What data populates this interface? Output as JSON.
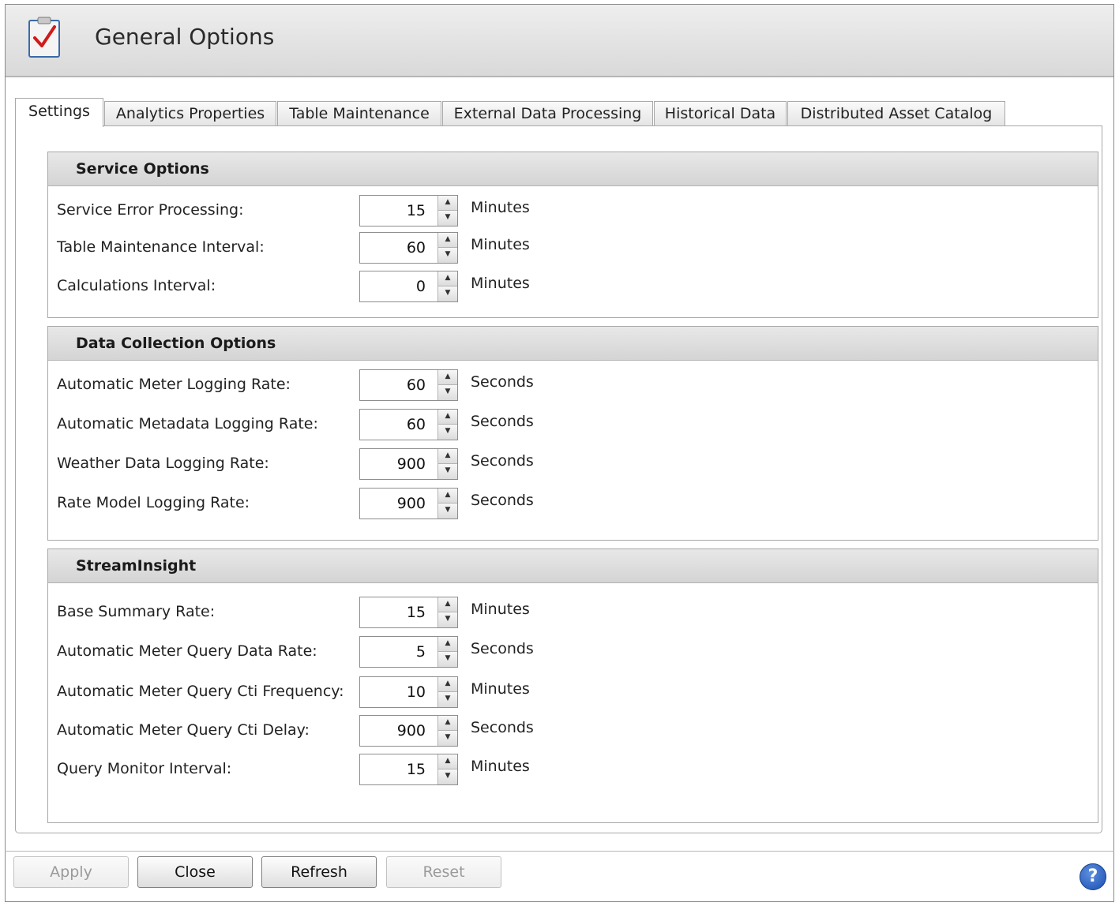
{
  "window": {
    "title": "General Options"
  },
  "tabs": [
    {
      "label": "Settings",
      "active": true
    },
    {
      "label": "Analytics Properties",
      "active": false
    },
    {
      "label": "Table Maintenance",
      "active": false
    },
    {
      "label": "External Data Processing",
      "active": false
    },
    {
      "label": "Historical Data",
      "active": false
    },
    {
      "label": "Distributed Asset Catalog",
      "active": false
    }
  ],
  "service_options": {
    "title": "Service Options",
    "rows": [
      {
        "label": "Service Error Processing:",
        "value": "15",
        "unit": "Minutes"
      },
      {
        "label": "Table Maintenance Interval:",
        "value": "60",
        "unit": "Minutes"
      },
      {
        "label": "Calculations Interval:",
        "value": "0",
        "unit": "Minutes"
      }
    ]
  },
  "data_collection": {
    "title": "Data Collection Options",
    "rows": [
      {
        "label": "Automatic Meter Logging Rate:",
        "value": "60",
        "unit": "Seconds"
      },
      {
        "label": "Automatic Metadata Logging Rate:",
        "value": "60",
        "unit": "Seconds"
      },
      {
        "label": "Weather Data Logging Rate:",
        "value": "900",
        "unit": "Seconds"
      },
      {
        "label": "Rate Model Logging Rate:",
        "value": "900",
        "unit": "Seconds"
      }
    ]
  },
  "stream_insight": {
    "title": "StreamInsight",
    "rows": [
      {
        "label": "Base Summary Rate:",
        "value": "15",
        "unit": "Minutes"
      },
      {
        "label": "Automatic Meter Query Data Rate:",
        "value": "5",
        "unit": "Seconds"
      },
      {
        "label": "Automatic Meter Query Cti Frequency:",
        "value": "10",
        "unit": "Minutes"
      },
      {
        "label": "Automatic Meter Query Cti Delay:",
        "value": "900",
        "unit": "Seconds"
      },
      {
        "label": "Query Monitor Interval:",
        "value": "15",
        "unit": "Minutes"
      }
    ]
  },
  "footer": {
    "apply": "Apply",
    "close": "Close",
    "refresh": "Refresh",
    "reset": "Reset",
    "help": "?"
  },
  "icons": {
    "app": "clipboard-check-icon",
    "spin_up": "arrow-up-icon",
    "spin_down": "arrow-down-icon",
    "help": "help-icon"
  }
}
